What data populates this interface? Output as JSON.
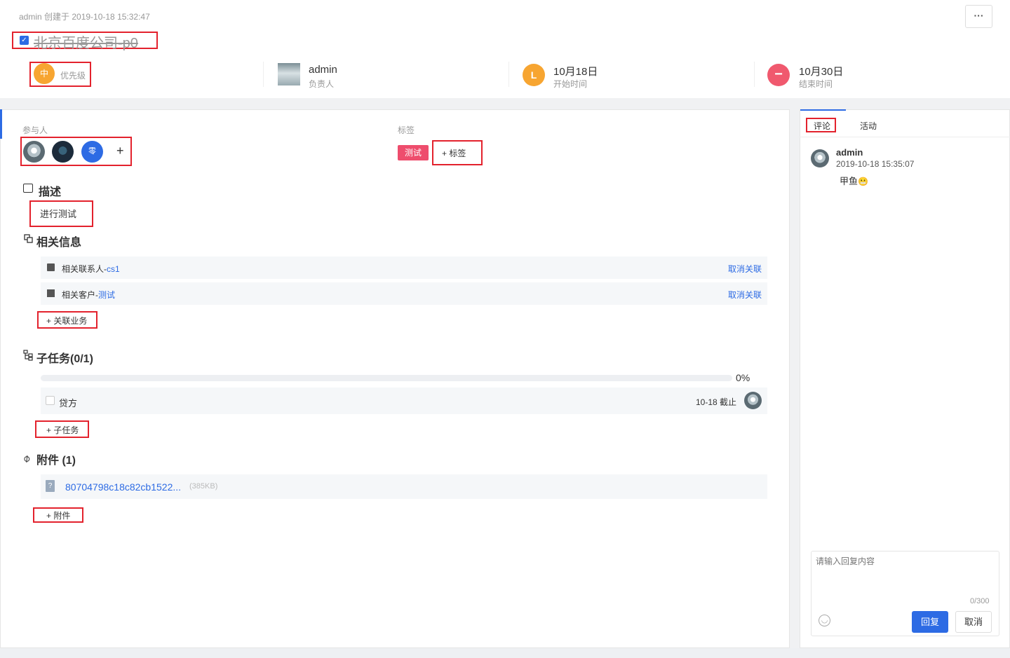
{
  "header": {
    "meta": "admin 创建于 2019-10-18 15:32:47",
    "more_label": "···",
    "title": "北京百度公司-p0",
    "priority": {
      "badge": "中",
      "label": "优先级",
      "color": "#f7a531"
    },
    "owner": {
      "name": "admin",
      "label": "负责人"
    },
    "start": {
      "badge": "L",
      "date": "10月18日",
      "label": "开始时间",
      "color": "#f7a531"
    },
    "end": {
      "badge": "−",
      "date": "10月30日",
      "label": "结束时间",
      "color": "#f0596e"
    }
  },
  "participants": {
    "label": "参与人",
    "avatars": [
      "avatar-1",
      "avatar-2"
    ],
    "third_badge": "零",
    "add_label": "+"
  },
  "tags": {
    "label": "标签",
    "items": [
      "测试"
    ],
    "add_label": "+ 标签"
  },
  "description": {
    "title": "描述",
    "text": "进行测试"
  },
  "related": {
    "title": "相关信息",
    "items": [
      {
        "prefix": "相关联系人-",
        "link": "cs1",
        "action": "取消关联"
      },
      {
        "prefix": "相关客户-",
        "link": "测试",
        "action": "取消关联"
      }
    ],
    "add_label": "+ 关联业务"
  },
  "subtasks": {
    "title": "子任务(0/1)",
    "progress_pct": 0,
    "progress_text": "0%",
    "items": [
      {
        "name": "贷方",
        "due": "10-18 截止"
      }
    ],
    "add_label": "+ 子任务"
  },
  "attachments": {
    "title": "附件 (1)",
    "items": [
      {
        "name": "80704798c18c82cb1522...",
        "size": "(385KB)",
        "icon": "?"
      }
    ],
    "add_label": "+ 附件"
  },
  "sidebar": {
    "tabs": [
      "评论",
      "活动"
    ],
    "comment": {
      "user": "admin",
      "time": "2019-10-18 15:35:07",
      "text": "甲鱼",
      "emoji": "😬"
    },
    "reply": {
      "placeholder": "请输入回复内容",
      "counter": "0/300",
      "submit": "回复",
      "cancel": "取消"
    }
  },
  "colors": {
    "accent": "#2d6be4",
    "tag": "#ee4d6d",
    "highlight": "#e3222d"
  }
}
